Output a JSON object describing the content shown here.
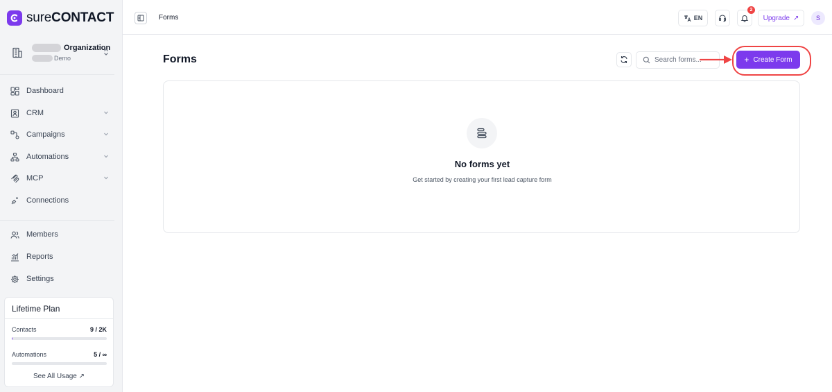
{
  "brand": {
    "name_part1": "sure",
    "name_part2": "CONTACT",
    "accent": "#7c3aed"
  },
  "org": {
    "name": "Organization",
    "subtitle": "Demo"
  },
  "sidebar": {
    "items": [
      {
        "label": "Dashboard",
        "icon": "dashboard-icon"
      },
      {
        "label": "CRM",
        "icon": "contact-card-icon",
        "has_chevron": true
      },
      {
        "label": "Campaigns",
        "icon": "campaigns-icon",
        "has_chevron": true
      },
      {
        "label": "Automations",
        "icon": "workflow-icon",
        "has_chevron": true
      },
      {
        "label": "MCP",
        "icon": "mcp-icon",
        "has_chevron": true
      },
      {
        "label": "Connections",
        "icon": "plug-icon"
      },
      {
        "label": "Members",
        "icon": "users-icon"
      },
      {
        "label": "Reports",
        "icon": "chart-icon"
      },
      {
        "label": "Settings",
        "icon": "gear-icon"
      }
    ]
  },
  "plan": {
    "title": "Lifetime Plan",
    "contacts_label": "Contacts",
    "contacts_value": "9 / 2K",
    "contacts_fraction": 0.0045,
    "automations_label": "Automations",
    "automations_value": "5 / ∞",
    "automations_fraction": 0,
    "see_all": "See All Usage"
  },
  "header": {
    "breadcrumb": "Forms",
    "language": "EN",
    "notifications_count": "2",
    "upgrade_label": "Upgrade",
    "avatar_initial": "S"
  },
  "main": {
    "title": "Forms",
    "search_placeholder": "Search forms...",
    "create_button": "Create Form",
    "empty_title": "No forms yet",
    "empty_subtitle": "Get started by creating your first lead capture form"
  },
  "colors": {
    "accent": "#7c3aed",
    "annotation_red": "#ef4444",
    "badge": "#ef4444"
  }
}
